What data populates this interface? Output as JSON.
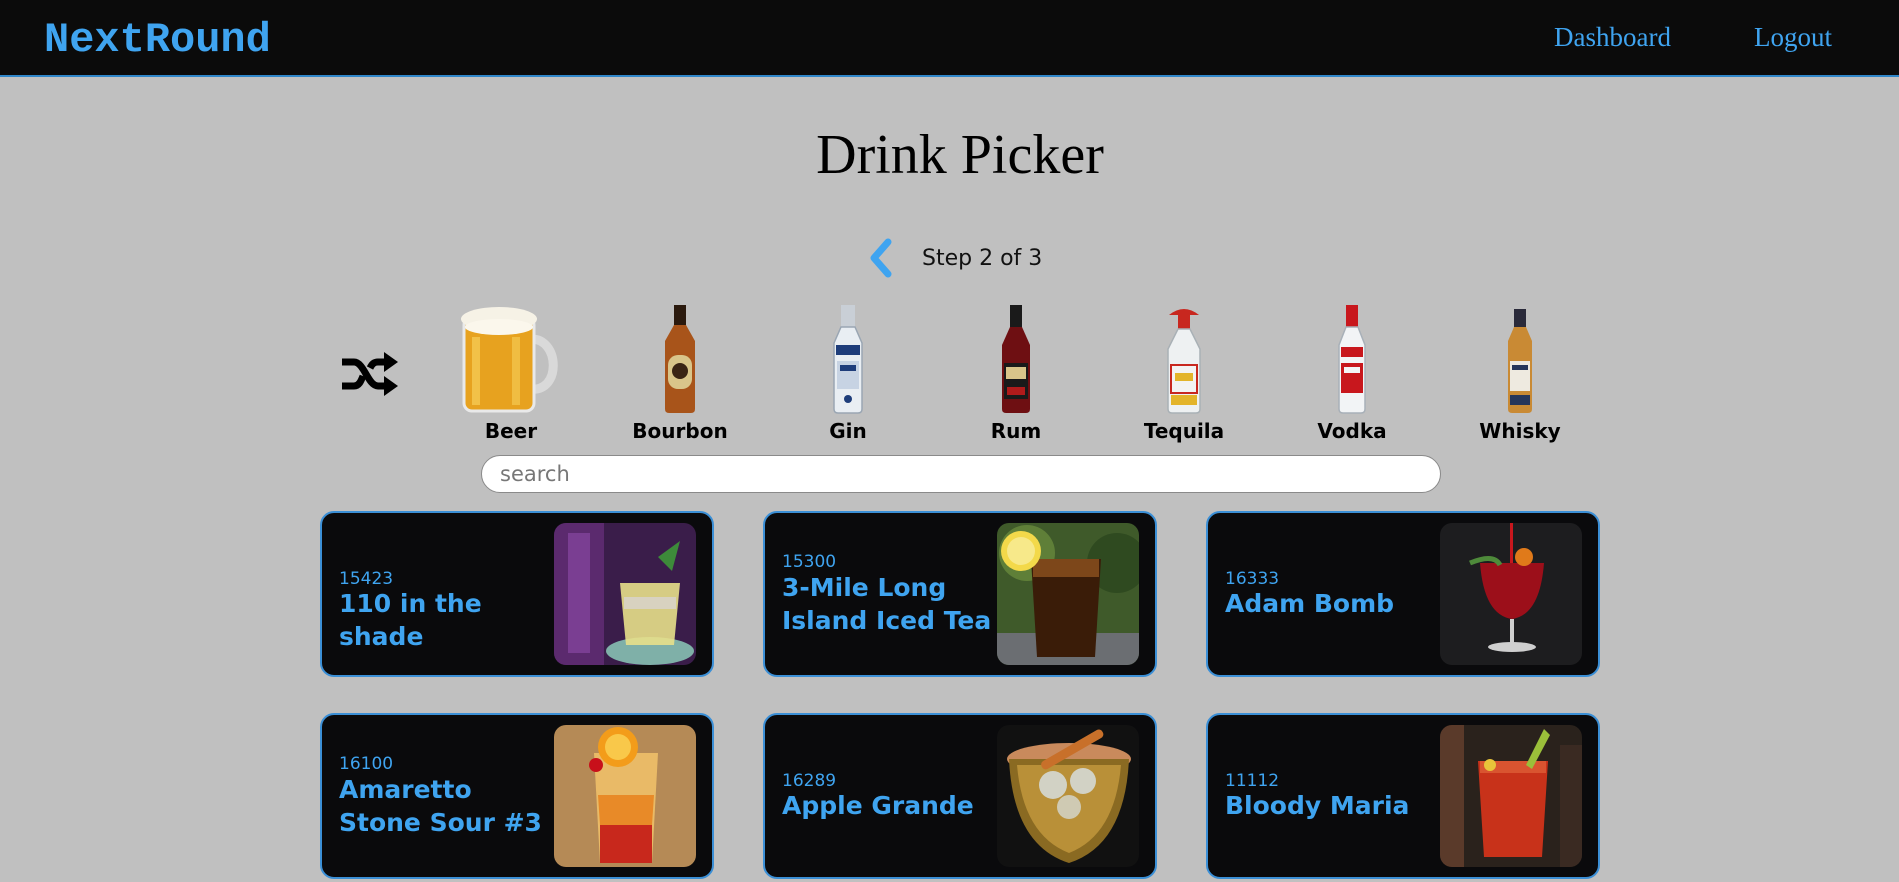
{
  "navbar": {
    "brand": "NextRound",
    "links": [
      "Dashboard",
      "Logout"
    ]
  },
  "page": {
    "title": "Drink Picker",
    "step_text": "Step 2 of 3"
  },
  "spirits": [
    "Beer",
    "Bourbon",
    "Gin",
    "Rum",
    "Tequila",
    "Vodka",
    "Whisky"
  ],
  "search": {
    "placeholder": "search",
    "value": ""
  },
  "drinks": [
    {
      "id": "15423",
      "name": "110 in the shade"
    },
    {
      "id": "15300",
      "name": "3-Mile Long Island Iced Tea"
    },
    {
      "id": "16333",
      "name": "Adam Bomb"
    },
    {
      "id": "16100",
      "name": "Amaretto Stone Sour #3"
    },
    {
      "id": "16289",
      "name": "Apple Grande"
    },
    {
      "id": "11112",
      "name": "Bloody Maria"
    }
  ],
  "colors": {
    "accent": "#3fa4f0",
    "navbar_bg": "#0b0b0b",
    "page_bg": "#c0c0c0",
    "card_bg": "#0a0a0c"
  },
  "icons": [
    "chevron-left-icon",
    "shuffle-icon"
  ]
}
